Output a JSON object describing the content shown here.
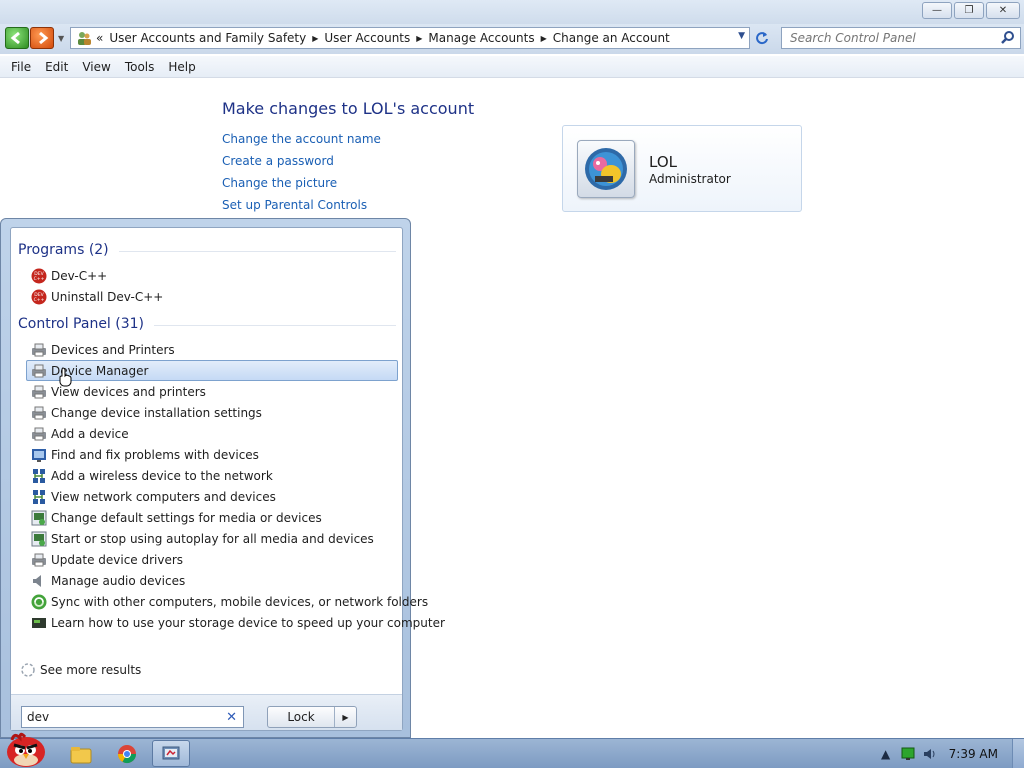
{
  "window": {
    "minimize_symbol": "—",
    "maximize_symbol": "❐",
    "close_symbol": "✕"
  },
  "addressbar": {
    "overflow": "«",
    "breadcrumbs": [
      "User Accounts and Family Safety",
      "User Accounts",
      "Manage Accounts",
      "Change an Account"
    ],
    "search_placeholder": "Search Control Panel"
  },
  "menu": [
    "File",
    "Edit",
    "View",
    "Tools",
    "Help"
  ],
  "page": {
    "title": "Make changes to LOL's account",
    "links": [
      "Change the account name",
      "Create a password",
      "Change the picture",
      "Set up Parental Controls"
    ]
  },
  "account": {
    "name": "LOL",
    "role": "Administrator",
    "picture_icon": "user-picture-icon"
  },
  "start_menu": {
    "programs_header": "Programs (2)",
    "programs": [
      {
        "label": "Dev-C++",
        "icon": "devcpp-icon"
      },
      {
        "label": "Uninstall Dev-C++",
        "icon": "devcpp-icon"
      }
    ],
    "control_panel_header": "Control Panel (31)",
    "control_panel_items": [
      {
        "label": "Devices and Printers",
        "icon": "printer-icon"
      },
      {
        "label": "Device Manager",
        "icon": "printer-icon",
        "selected": true
      },
      {
        "label": "View devices and printers",
        "icon": "printer-icon"
      },
      {
        "label": "Change device installation settings",
        "icon": "printer-icon"
      },
      {
        "label": "Add a device",
        "icon": "printer-icon"
      },
      {
        "label": "Find and fix problems with devices",
        "icon": "troubleshoot-icon"
      },
      {
        "label": "Add a wireless device to the network",
        "icon": "network-icon"
      },
      {
        "label": "View network computers and devices",
        "icon": "network-icon"
      },
      {
        "label": "Change default settings for media or devices",
        "icon": "autoplay-icon"
      },
      {
        "label": "Start or stop using autoplay for all media and devices",
        "icon": "autoplay-icon"
      },
      {
        "label": "Update device drivers",
        "icon": "printer-icon"
      },
      {
        "label": "Manage audio devices",
        "icon": "speaker-icon"
      },
      {
        "label": "Sync with other computers, mobile devices, or network folders",
        "icon": "sync-icon"
      },
      {
        "label": "Learn how to use your storage device to speed up your computer",
        "icon": "storage-icon"
      }
    ],
    "see_more": "See more results",
    "search_value": "dev",
    "clear_symbol": "✕",
    "lock_label": "Lock",
    "lock_arrow": "▶"
  },
  "taskbar": {
    "clock": "7:39 AM",
    "pinned": [
      "explorer-icon",
      "chrome-icon",
      "control-panel-icon"
    ],
    "tray": [
      "show-hidden-icons",
      "network-status-icon",
      "volume-icon"
    ]
  },
  "colors": {
    "link": "#1a5fb4",
    "heading": "#1e3287",
    "selection": "#c5daf5"
  }
}
